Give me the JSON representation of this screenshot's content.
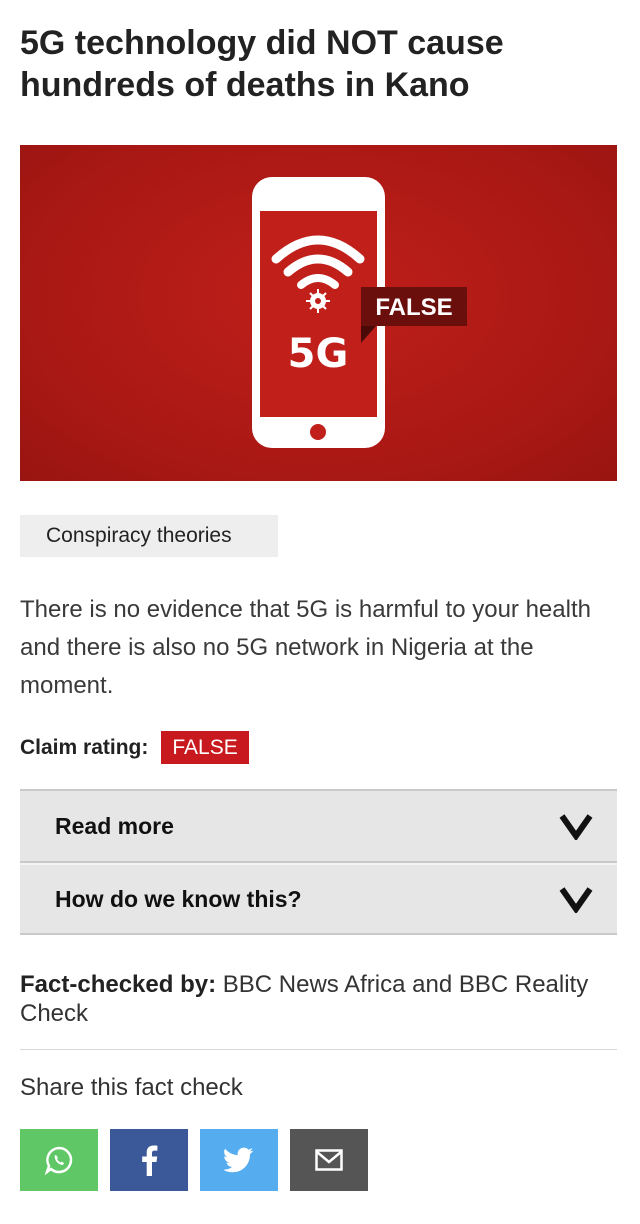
{
  "article": {
    "title": "5G technology did NOT cause hundreds of deaths in Kano"
  },
  "hero": {
    "phone_text": "5G",
    "badge": "FALSE"
  },
  "tag": {
    "label": "Conspiracy theories"
  },
  "summary": {
    "text": "There is no evidence that 5G is harmful to your health and there is also no 5G network in Nigeria at the moment."
  },
  "rating": {
    "label": "Claim rating:",
    "value": "FALSE"
  },
  "accordion": [
    {
      "label": "Read more",
      "icon": "chevron-down-icon"
    },
    {
      "label": "How do we know this?",
      "icon": "chevron-down-icon"
    }
  ],
  "factcheck": {
    "label": "Fact-checked by:",
    "value": "BBC News Africa and BBC Reality Check"
  },
  "share": {
    "title": "Share this fact check",
    "buttons": [
      {
        "network": "whatsapp",
        "icon": "whatsapp-icon",
        "color": "#5fc766"
      },
      {
        "network": "facebook",
        "icon": "facebook-icon",
        "color": "#3b5998"
      },
      {
        "network": "twitter",
        "icon": "twitter-icon",
        "color": "#55acee"
      },
      {
        "network": "email",
        "icon": "email-icon",
        "color": "#555555"
      }
    ]
  },
  "colors": {
    "false_red": "#c8191e",
    "hero_red": "#a81814",
    "badge_dark": "#6b0f0c"
  }
}
